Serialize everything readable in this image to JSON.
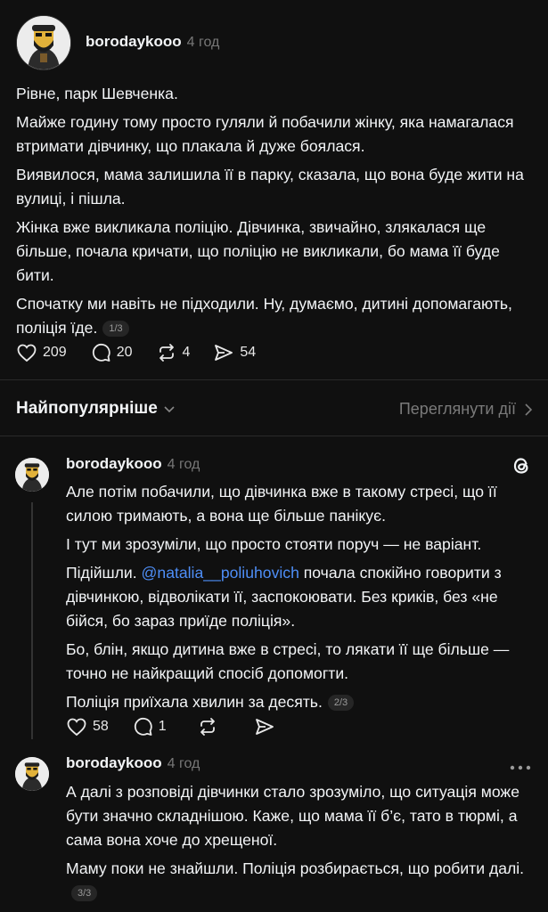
{
  "main_post": {
    "username": "borodaykooo",
    "time": "4 год",
    "paragraphs": [
      "Рівне, парк Шевченка.",
      "Майже годину тому просто гуляли й побачили жінку, яка намагалася втримати дівчинку, що плакала й дуже боялася.",
      "Виявилося, мама залишила її в парку, сказала, що вона буде жити на вулиці, і пішла.",
      "Жінка вже викликала поліцію. Дівчинка, звичайно, злякалася ще більше, почала кричати, що поліцію не викликали, бо мама її буде бити.",
      "Спочатку ми навіть не підходили. Ну, думаємо, дитині допомагають, поліція їде."
    ],
    "pager": "1/3",
    "likes": "209",
    "comments": "20",
    "reposts": "4",
    "shares": "54"
  },
  "sort_bar": {
    "label": "Найпопулярніше",
    "activity_link": "Переглянути дії"
  },
  "reply1": {
    "username": "borodaykooo",
    "time": "4 год",
    "p1": "Але потім побачили, що дівчинка вже в такому стресі, що її силою тримають, а вона ще більше панікує.",
    "p2": "І тут ми зрозуміли, що просто стояти поруч — не варіант.",
    "p3_before": "Підійшли. ",
    "p3_mention": "@natalia__poliuhovich",
    "p3_after": " почала спокійно говорити з дівчинкою, відволікати її, заспокоювати. Без криків, без «не бійся, бо зараз приїде поліція».",
    "p4": "Бо, блін, якщо дитина вже в стресі, то лякати її ще більше — точно не найкращий спосіб допомогти.",
    "p5": "Поліція приїхала хвилин за десять.",
    "pager": "2/3",
    "likes": "58",
    "comments": "1"
  },
  "reply2": {
    "username": "borodaykooo",
    "time": "4 год",
    "p1": "А далі з розповіді дівчинки стало зрозуміло, що ситуація може бути значно складнішою. Каже, що мама її б’є, тато в тюрмі, а сама вона хоче до хрещеної.",
    "p2": "Маму поки не знайшли. Поліція розбирається, що робити далі.",
    "pager": "3/3"
  },
  "icons": [
    "heart-icon",
    "comment-icon",
    "repost-icon",
    "share-icon",
    "chevron-down-icon",
    "chevron-right-icon",
    "threads-logo-icon",
    "more-icon"
  ]
}
